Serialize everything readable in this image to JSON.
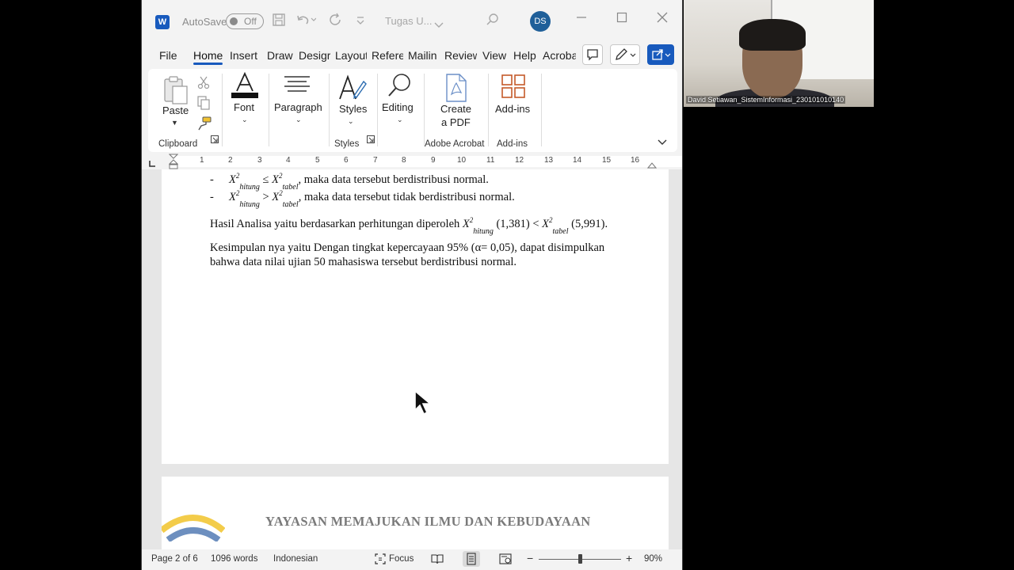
{
  "titlebar": {
    "app_logo": "W",
    "autosave_label": "AutoSave",
    "autosave_state": "Off",
    "document_title": "Tugas U...",
    "user_initials": "DS"
  },
  "tabs": [
    "File",
    "Home",
    "Insert",
    "Draw",
    "Design",
    "Layout",
    "References",
    "Mailings",
    "Review",
    "View",
    "Help",
    "Acrobat"
  ],
  "tabs_display": [
    "File",
    "Home",
    "Insert",
    "Draw",
    "Desigr",
    "Layout",
    "Refere",
    "Mailin",
    "Review",
    "View",
    "Help",
    "Acroba"
  ],
  "active_tab": "Home",
  "ribbon": {
    "paste_label": "Paste",
    "clipboard_group": "Clipboard",
    "font_label": "Font",
    "paragraph_label": "Paragraph",
    "styles_label": "Styles",
    "styles_group": "Styles",
    "editing_label": "Editing",
    "create_pdf_line1": "Create",
    "create_pdf_line2": "a PDF",
    "acrobat_group": "Adobe Acrobat",
    "addins_label": "Add-ins",
    "addins_group": "Add-ins"
  },
  "ruler_numbers": [
    "1",
    "2",
    "3",
    "4",
    "5",
    "6",
    "7",
    "8",
    "9",
    "10",
    "11",
    "12",
    "13",
    "14",
    "15",
    "16"
  ],
  "document": {
    "bullet_marker": "-",
    "rule1_rel": "≤",
    "rule1_text": ", maka data tersebut berdistribusi normal.",
    "rule2_rel": ">",
    "rule2_text": ", maka data tersebut tidak berdistribusi normal.",
    "chi_symbol": "X",
    "sup": "2",
    "sub_hitung": "hitung",
    "sub_tabel": "tabel",
    "hasil_prefix": "Hasil Analisa yaitu berdasarkan perhitungan diperoleh ",
    "hasil_val1": " (1,381) < ",
    "hasil_val2": " (5,991).",
    "kesimpulan_line1": "Kesimpulan nya yaitu Dengan tingkat kepercayaan 95% (α= 0,05), dapat disimpulkan",
    "kesimpulan_line2": "bahwa data nilai ujian 50 mahasiswa tersebut berdistribusi normal.",
    "letterhead": "YAYASAN MEMAJUKAN ILMU DAN KEBUDAYAAN"
  },
  "status": {
    "page": "Page 2 of 6",
    "words": "1096 words",
    "language": "Indonesian",
    "focus": "Focus",
    "zoom_minus": "−",
    "zoom_plus": "+",
    "zoom": "90%",
    "zoom_level_fraction": 0.5
  },
  "webcam": {
    "participant_name": "David Setiawan_SistemInformasi_230101010140"
  },
  "colors": {
    "accent": "#185abd",
    "ribbon_bg": "#ffffff",
    "app_bg": "#f3f3f3",
    "letterhead": "#7a7a7a",
    "logo_yellow": "#f3cc4a",
    "logo_blue": "#6d8fbf"
  }
}
